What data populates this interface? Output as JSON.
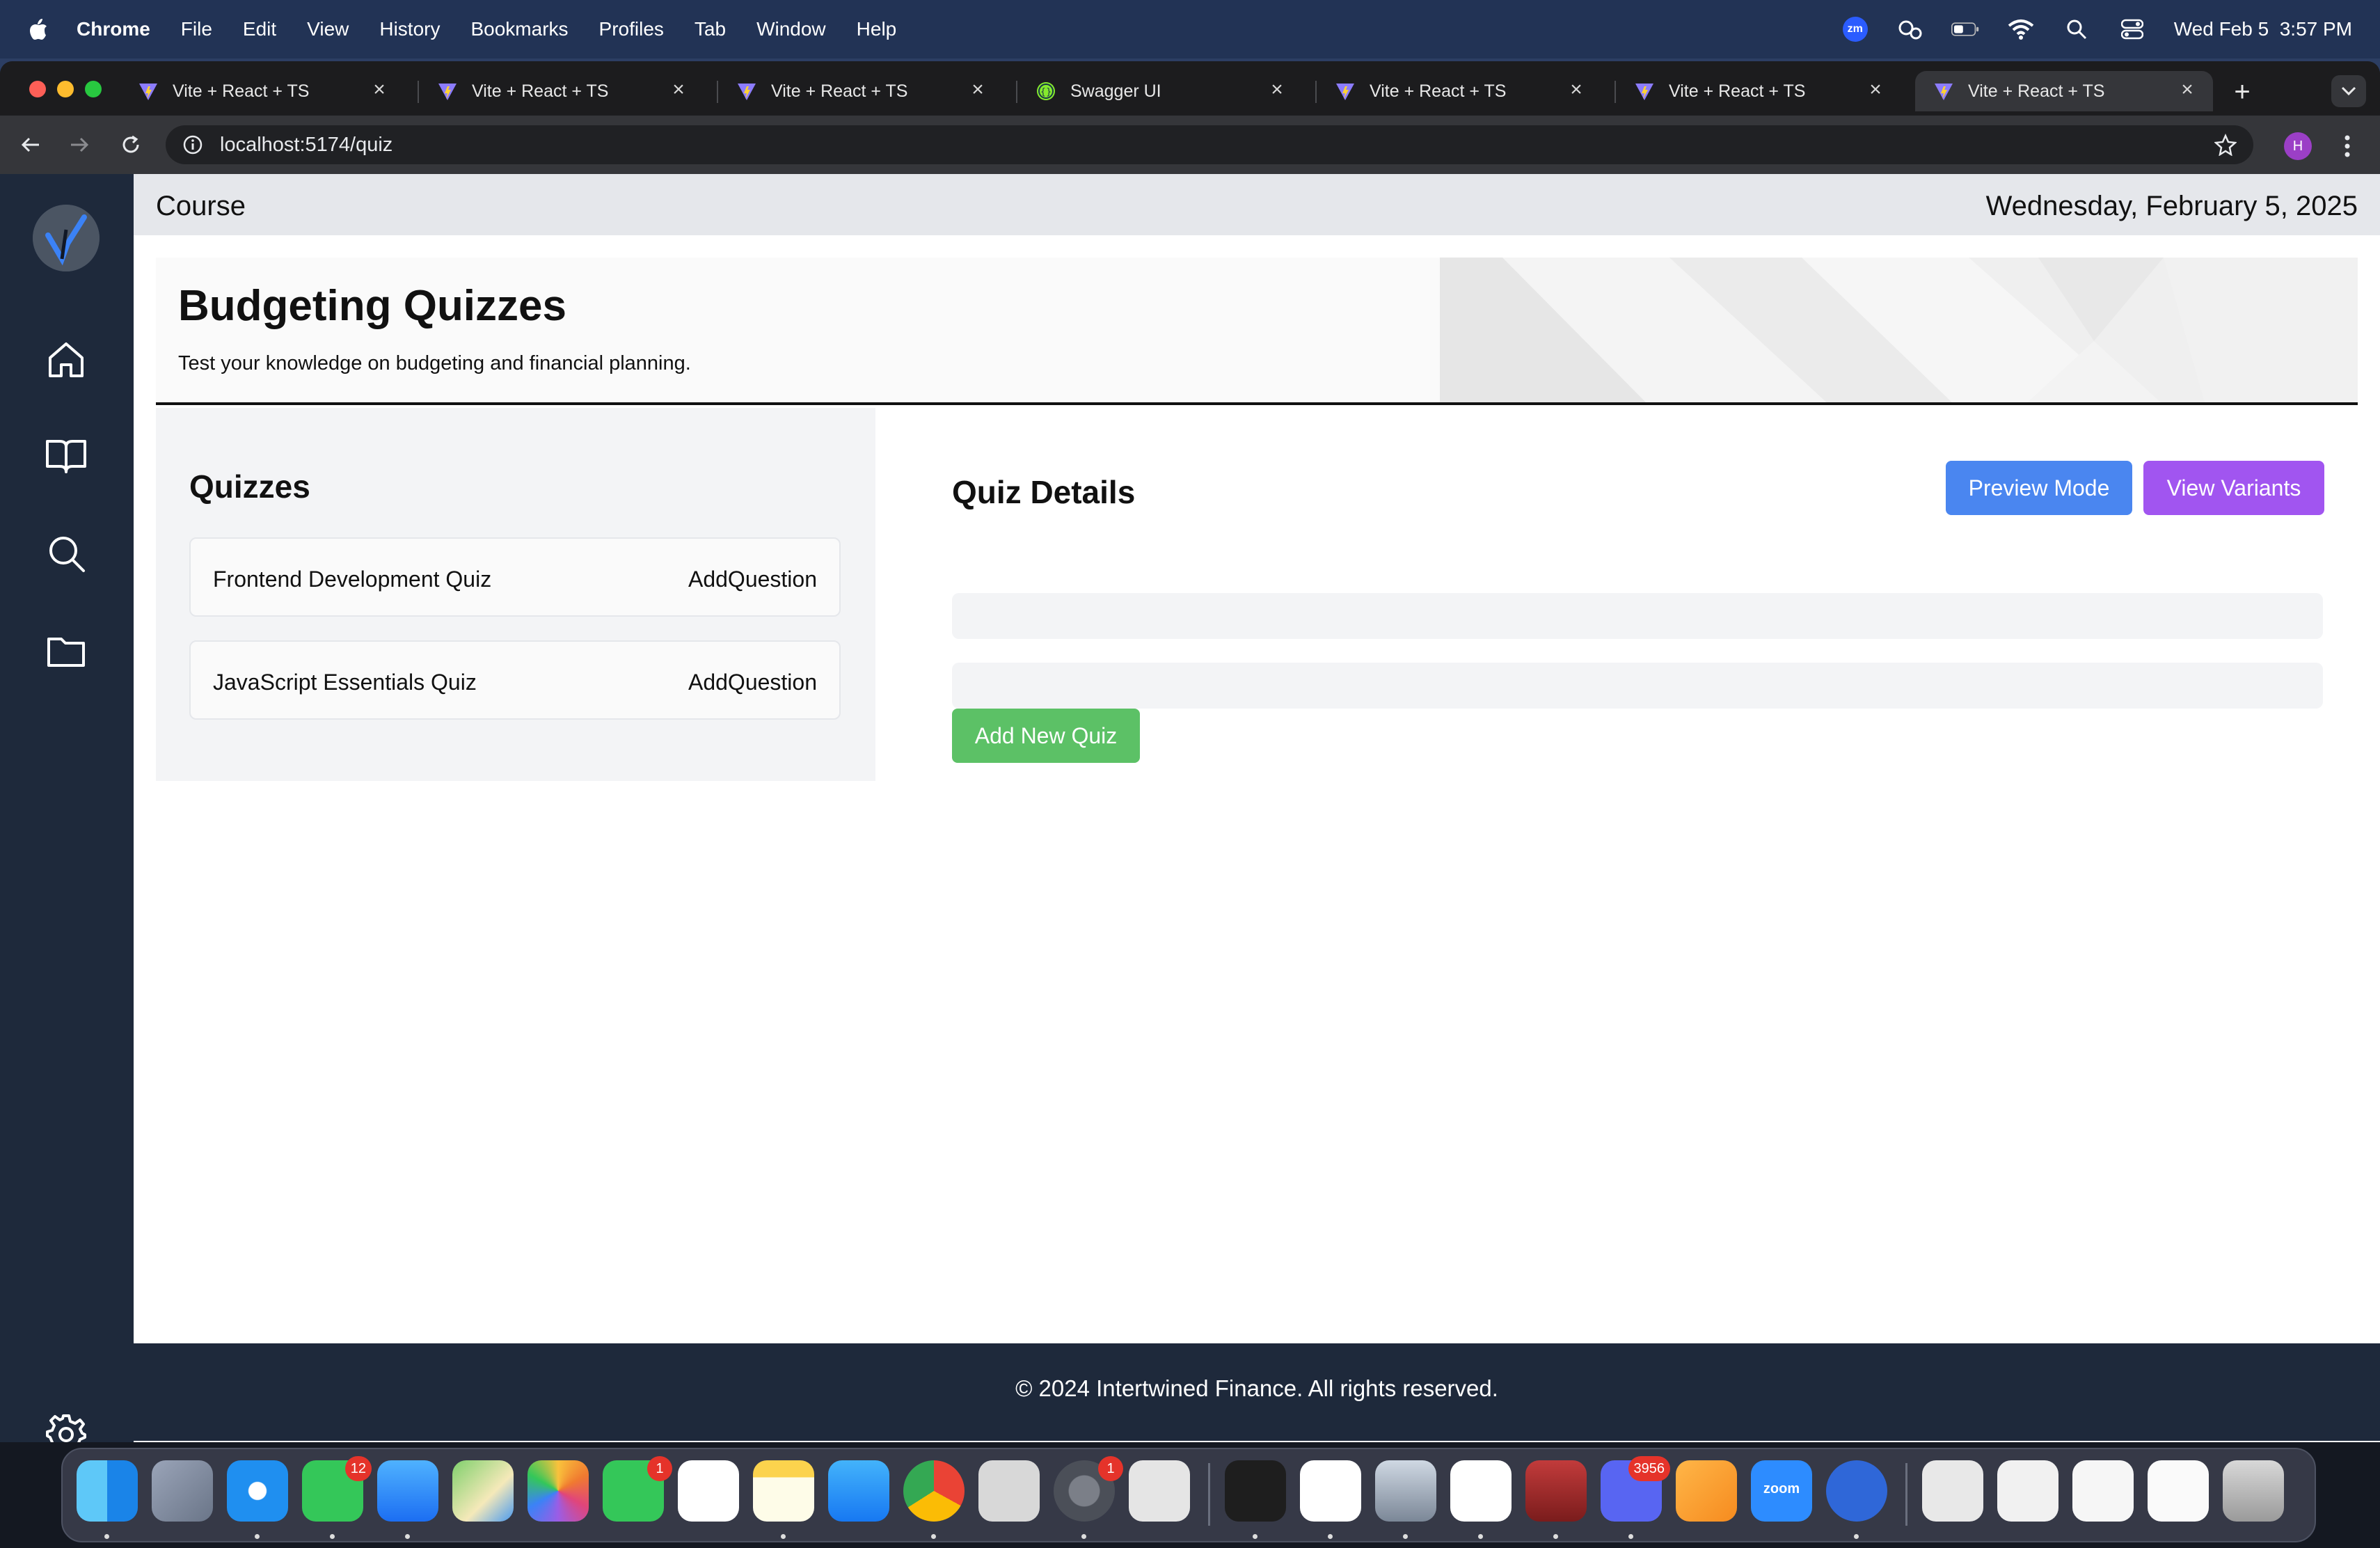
{
  "menubar": {
    "app_name": "Chrome",
    "items": [
      "File",
      "Edit",
      "View",
      "History",
      "Bookmarks",
      "Profiles",
      "Tab",
      "Window",
      "Help"
    ],
    "zoom_label": "zm",
    "clock": "Wed Feb 5  3:57 PM"
  },
  "browser": {
    "tabs": [
      {
        "title": "Vite + React + TS",
        "icon": "vite-icon"
      },
      {
        "title": "Vite + React + TS",
        "icon": "vite-icon"
      },
      {
        "title": "Vite + React + TS",
        "icon": "vite-icon"
      },
      {
        "title": "Swagger UI",
        "icon": "swagger-icon"
      },
      {
        "title": "Vite + React + TS",
        "icon": "vite-icon"
      },
      {
        "title": "Vite + React + TS",
        "icon": "vite-icon"
      },
      {
        "title": "Vite + React + TS",
        "icon": "vite-icon",
        "active": true
      }
    ],
    "url": "localhost:5174/quiz",
    "profile_initial": "H"
  },
  "page": {
    "topbar": {
      "section": "Course",
      "date": "Wednesday, February 5, 2025"
    },
    "hero": {
      "title": "Budgeting Quizzes",
      "subtitle": "Test your knowledge on budgeting and financial planning."
    },
    "quizzes": {
      "heading": "Quizzes",
      "items": [
        {
          "title": "Frontend Development Quiz",
          "action": "AddQuestion"
        },
        {
          "title": "JavaScript Essentials Quiz",
          "action": "AddQuestion"
        }
      ]
    },
    "details": {
      "heading": "Quiz Details",
      "preview_label": "Preview Mode",
      "variants_label": "View Variants",
      "add_label": "Add New Quiz"
    },
    "footer": "© 2024 Intertwined Finance. All rights reserved."
  },
  "dock": {
    "apps": [
      "Finder",
      "Launchpad",
      "Safari",
      "Messages",
      "Mail",
      "Maps",
      "Photos",
      "FaceTime",
      "Reminders",
      "Notes",
      "App Store",
      "Chrome",
      "Roblox Studio",
      "System Settings",
      "Roblox",
      "Terminal",
      "MongoDB Compass",
      "Preview",
      "Visual Studio Code",
      "Database",
      "Discord",
      "Pages",
      "Zoom",
      "Electron"
    ],
    "badges": {
      "messages": "12",
      "facetime": "1",
      "settings": "1",
      "discord": "3956"
    },
    "zoom_label": "zoom"
  },
  "colors": {
    "sidebar": "#1e293b",
    "preview_button": "#4a86f0",
    "variants_button": "#a155f0",
    "add_button": "#5cc166"
  }
}
